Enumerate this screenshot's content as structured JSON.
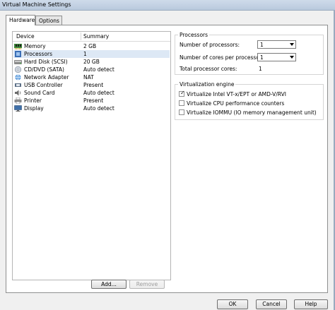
{
  "window": {
    "title": "Virtual Machine Settings"
  },
  "tabs": [
    {
      "label": "Hardware",
      "active": true
    },
    {
      "label": "Options",
      "active": false
    }
  ],
  "device_list": {
    "headers": {
      "device": "Device",
      "summary": "Summary"
    },
    "rows": [
      {
        "device": "Memory",
        "summary": "2 GB",
        "icon": "memory-icon"
      },
      {
        "device": "Processors",
        "summary": "1",
        "icon": "processor-icon",
        "selected": true
      },
      {
        "device": "Hard Disk (SCSI)",
        "summary": "20 GB",
        "icon": "hard-disk-icon"
      },
      {
        "device": "CD/DVD (SATA)",
        "summary": "Auto detect",
        "icon": "cd-dvd-icon"
      },
      {
        "device": "Network Adapter",
        "summary": "NAT",
        "icon": "network-adapter-icon"
      },
      {
        "device": "USB Controller",
        "summary": "Present",
        "icon": "usb-controller-icon"
      },
      {
        "device": "Sound Card",
        "summary": "Auto detect",
        "icon": "sound-card-icon"
      },
      {
        "device": "Printer",
        "summary": "Present",
        "icon": "printer-icon"
      },
      {
        "device": "Display",
        "summary": "Auto detect",
        "icon": "display-icon"
      }
    ]
  },
  "list_buttons": {
    "add": "Add...",
    "remove": "Remove"
  },
  "processors": {
    "group_title": "Processors",
    "num_processors_label": "Number of processors:",
    "num_processors_value": "1",
    "cores_label": "Number of cores per processor:",
    "cores_value": "1",
    "total_label": "Total processor cores:",
    "total_value": "1"
  },
  "virtualization": {
    "group_title": "Virtualization engine",
    "options": [
      {
        "label": "Virtualize Intel VT-x/EPT or AMD-V/RVI",
        "checked": true
      },
      {
        "label": "Virtualize CPU performance counters",
        "checked": false
      },
      {
        "label": "Virtualize IOMMU (IO memory management unit)",
        "checked": false
      }
    ]
  },
  "footer": {
    "ok": "OK",
    "cancel": "Cancel",
    "help": "Help"
  }
}
